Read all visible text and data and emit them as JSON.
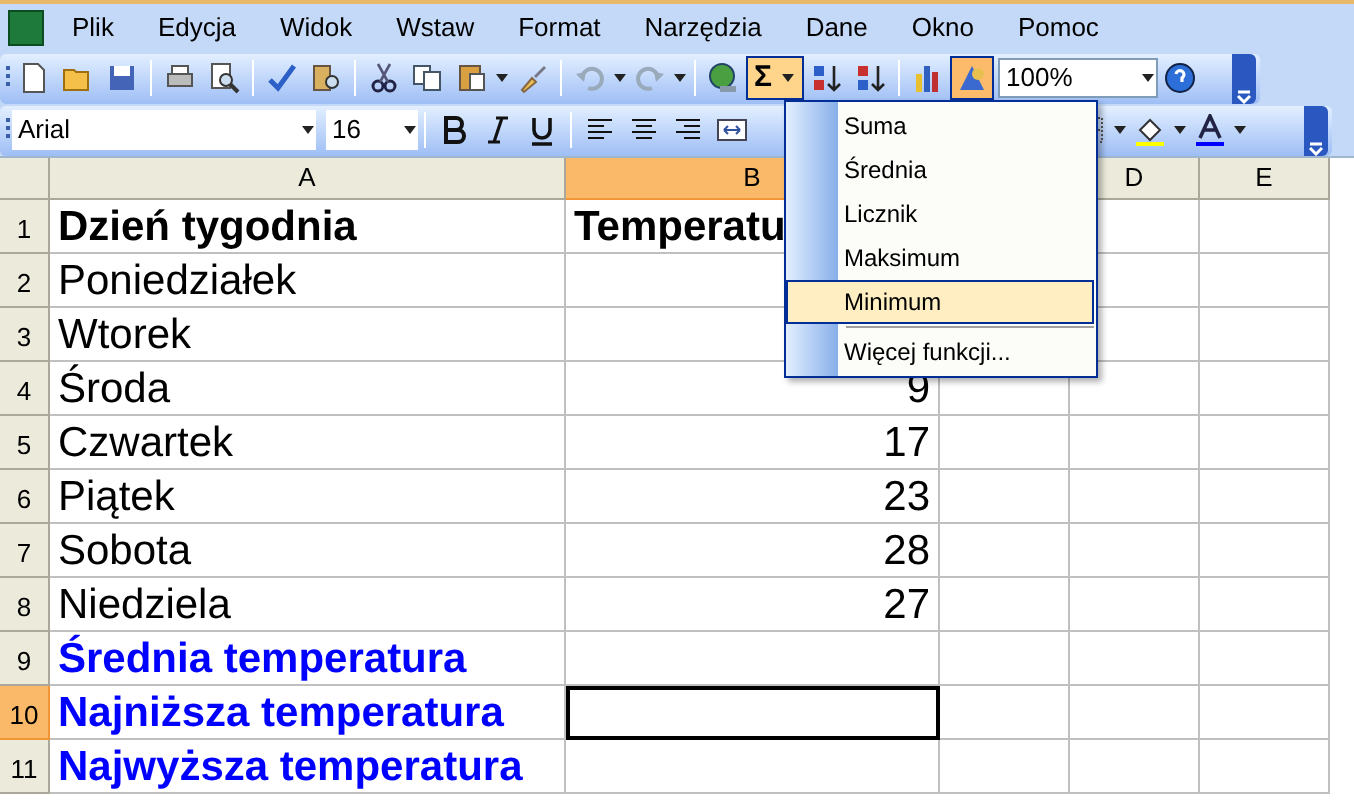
{
  "menu_bar": {
    "items": [
      "Plik",
      "Edycja",
      "Widok",
      "Wstaw",
      "Format",
      "Narzędzia",
      "Dane",
      "Okno",
      "Pomoc"
    ]
  },
  "standard_toolbar": {
    "autosum_pressed": true,
    "drawing_pressed": true,
    "zoom": "100%",
    "autosum_label": "Σ"
  },
  "formatting_toolbar": {
    "font": "Arial",
    "size": "16"
  },
  "columns": [
    {
      "label": "A",
      "selected": false
    },
    {
      "label": "B",
      "selected": true
    },
    {
      "label": "D",
      "selected": false
    },
    {
      "label": "E",
      "selected": false
    }
  ],
  "rows": [
    {
      "number": "1",
      "kind": "header",
      "a": "Dzień tygodnia",
      "b": "Temperatu",
      "selected": false,
      "active": false
    },
    {
      "number": "2",
      "kind": "day",
      "a": "Poniedziałek",
      "selected": false,
      "active": false
    },
    {
      "number": "3",
      "kind": "day",
      "a": "Wtorek",
      "selected": false,
      "active": false
    },
    {
      "number": "4",
      "kind": "day",
      "a": "Środa",
      "b": "9",
      "selected": false,
      "active": false
    },
    {
      "number": "5",
      "kind": "day",
      "a": "Czwartek",
      "b": "17",
      "selected": false,
      "active": false
    },
    {
      "number": "6",
      "kind": "day",
      "a": "Piątek",
      "b": "23",
      "selected": false,
      "active": false
    },
    {
      "number": "7",
      "kind": "day",
      "a": "Sobota",
      "b": "28",
      "selected": false,
      "active": false
    },
    {
      "number": "8",
      "kind": "day",
      "a": "Niedziela",
      "b": "27",
      "selected": false,
      "active": false
    },
    {
      "number": "9",
      "kind": "summary",
      "a": "Średnia temperatura",
      "selected": false,
      "active": false
    },
    {
      "number": "10",
      "kind": "summary",
      "a": "Najniższa temperatura",
      "selected": true,
      "active": true
    },
    {
      "number": "11",
      "kind": "summary",
      "a": "Najwyższa temperatura",
      "selected": false,
      "active": false
    }
  ],
  "autosum_menu": {
    "items": [
      {
        "label": "Suma",
        "selected": false
      },
      {
        "label": "Średnia",
        "selected": false
      },
      {
        "label": "Licznik",
        "selected": false
      },
      {
        "label": "Maksimum",
        "selected": false
      },
      {
        "label": "Minimum",
        "selected": true
      },
      {
        "label": "Więcej funkcji...",
        "selected": false,
        "separator_before": true
      }
    ]
  }
}
